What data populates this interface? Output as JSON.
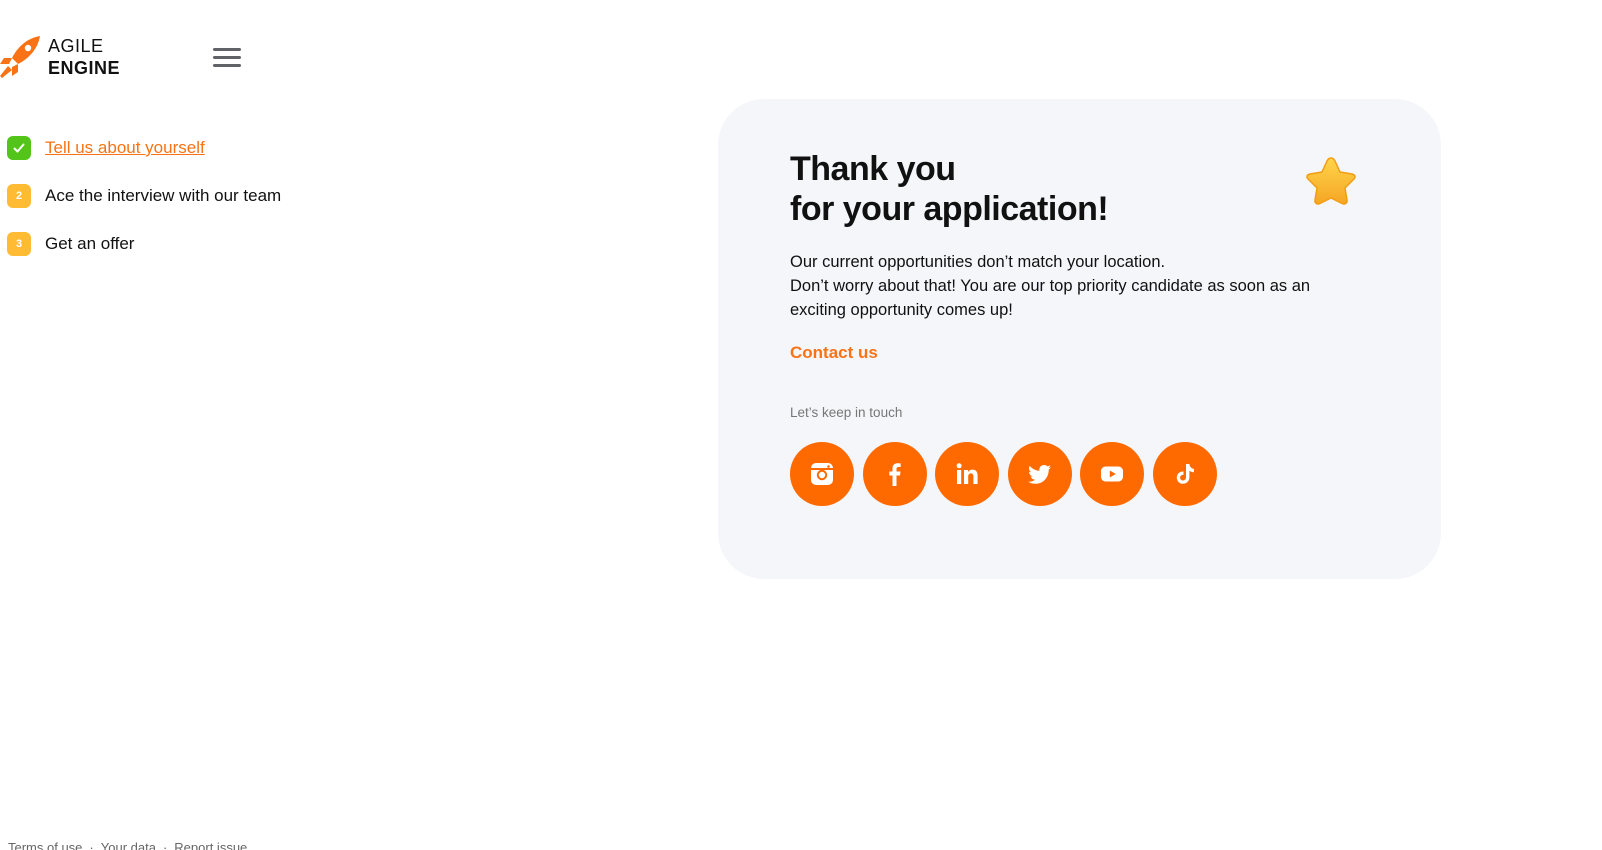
{
  "brand": {
    "line1": "AGILE",
    "line2": "ENGINE",
    "accent": "#f97316"
  },
  "header": {
    "menu_icon": "hamburger-menu-icon"
  },
  "steps": [
    {
      "badge": "",
      "icon": "check-icon",
      "label": "Tell us about yourself",
      "status": "done",
      "color": "#52c41a"
    },
    {
      "badge": "2",
      "label": "Ace the interview with our team",
      "status": "pending",
      "color": "#ffbb33"
    },
    {
      "badge": "3",
      "label": "Get an offer",
      "status": "pending",
      "color": "#ffbb33"
    }
  ],
  "card": {
    "title_line1": "Thank you",
    "title_line2": "for your application!",
    "decoration_icon": "star-icon",
    "message_line1": "Our current opportunities don’t match your location.",
    "message_line2": "Don’t worry about that! You are our top priority candidate as soon as an exciting opportunity comes up!",
    "contact_label": "Contact us",
    "touch_label": "Let’s keep in touch",
    "background": "#f5f6fa"
  },
  "socials": [
    {
      "name": "instagram",
      "icon": "instagram-icon"
    },
    {
      "name": "facebook",
      "icon": "facebook-icon"
    },
    {
      "name": "linkedin",
      "icon": "linkedin-icon"
    },
    {
      "name": "twitter",
      "icon": "twitter-icon"
    },
    {
      "name": "youtube",
      "icon": "youtube-icon"
    },
    {
      "name": "tiktok",
      "icon": "tiktok-icon"
    }
  ],
  "social_color": "#ff6a00",
  "footer": {
    "terms": "Terms of use",
    "your_data": "Your data",
    "report": "Report issue",
    "separator": "·"
  }
}
